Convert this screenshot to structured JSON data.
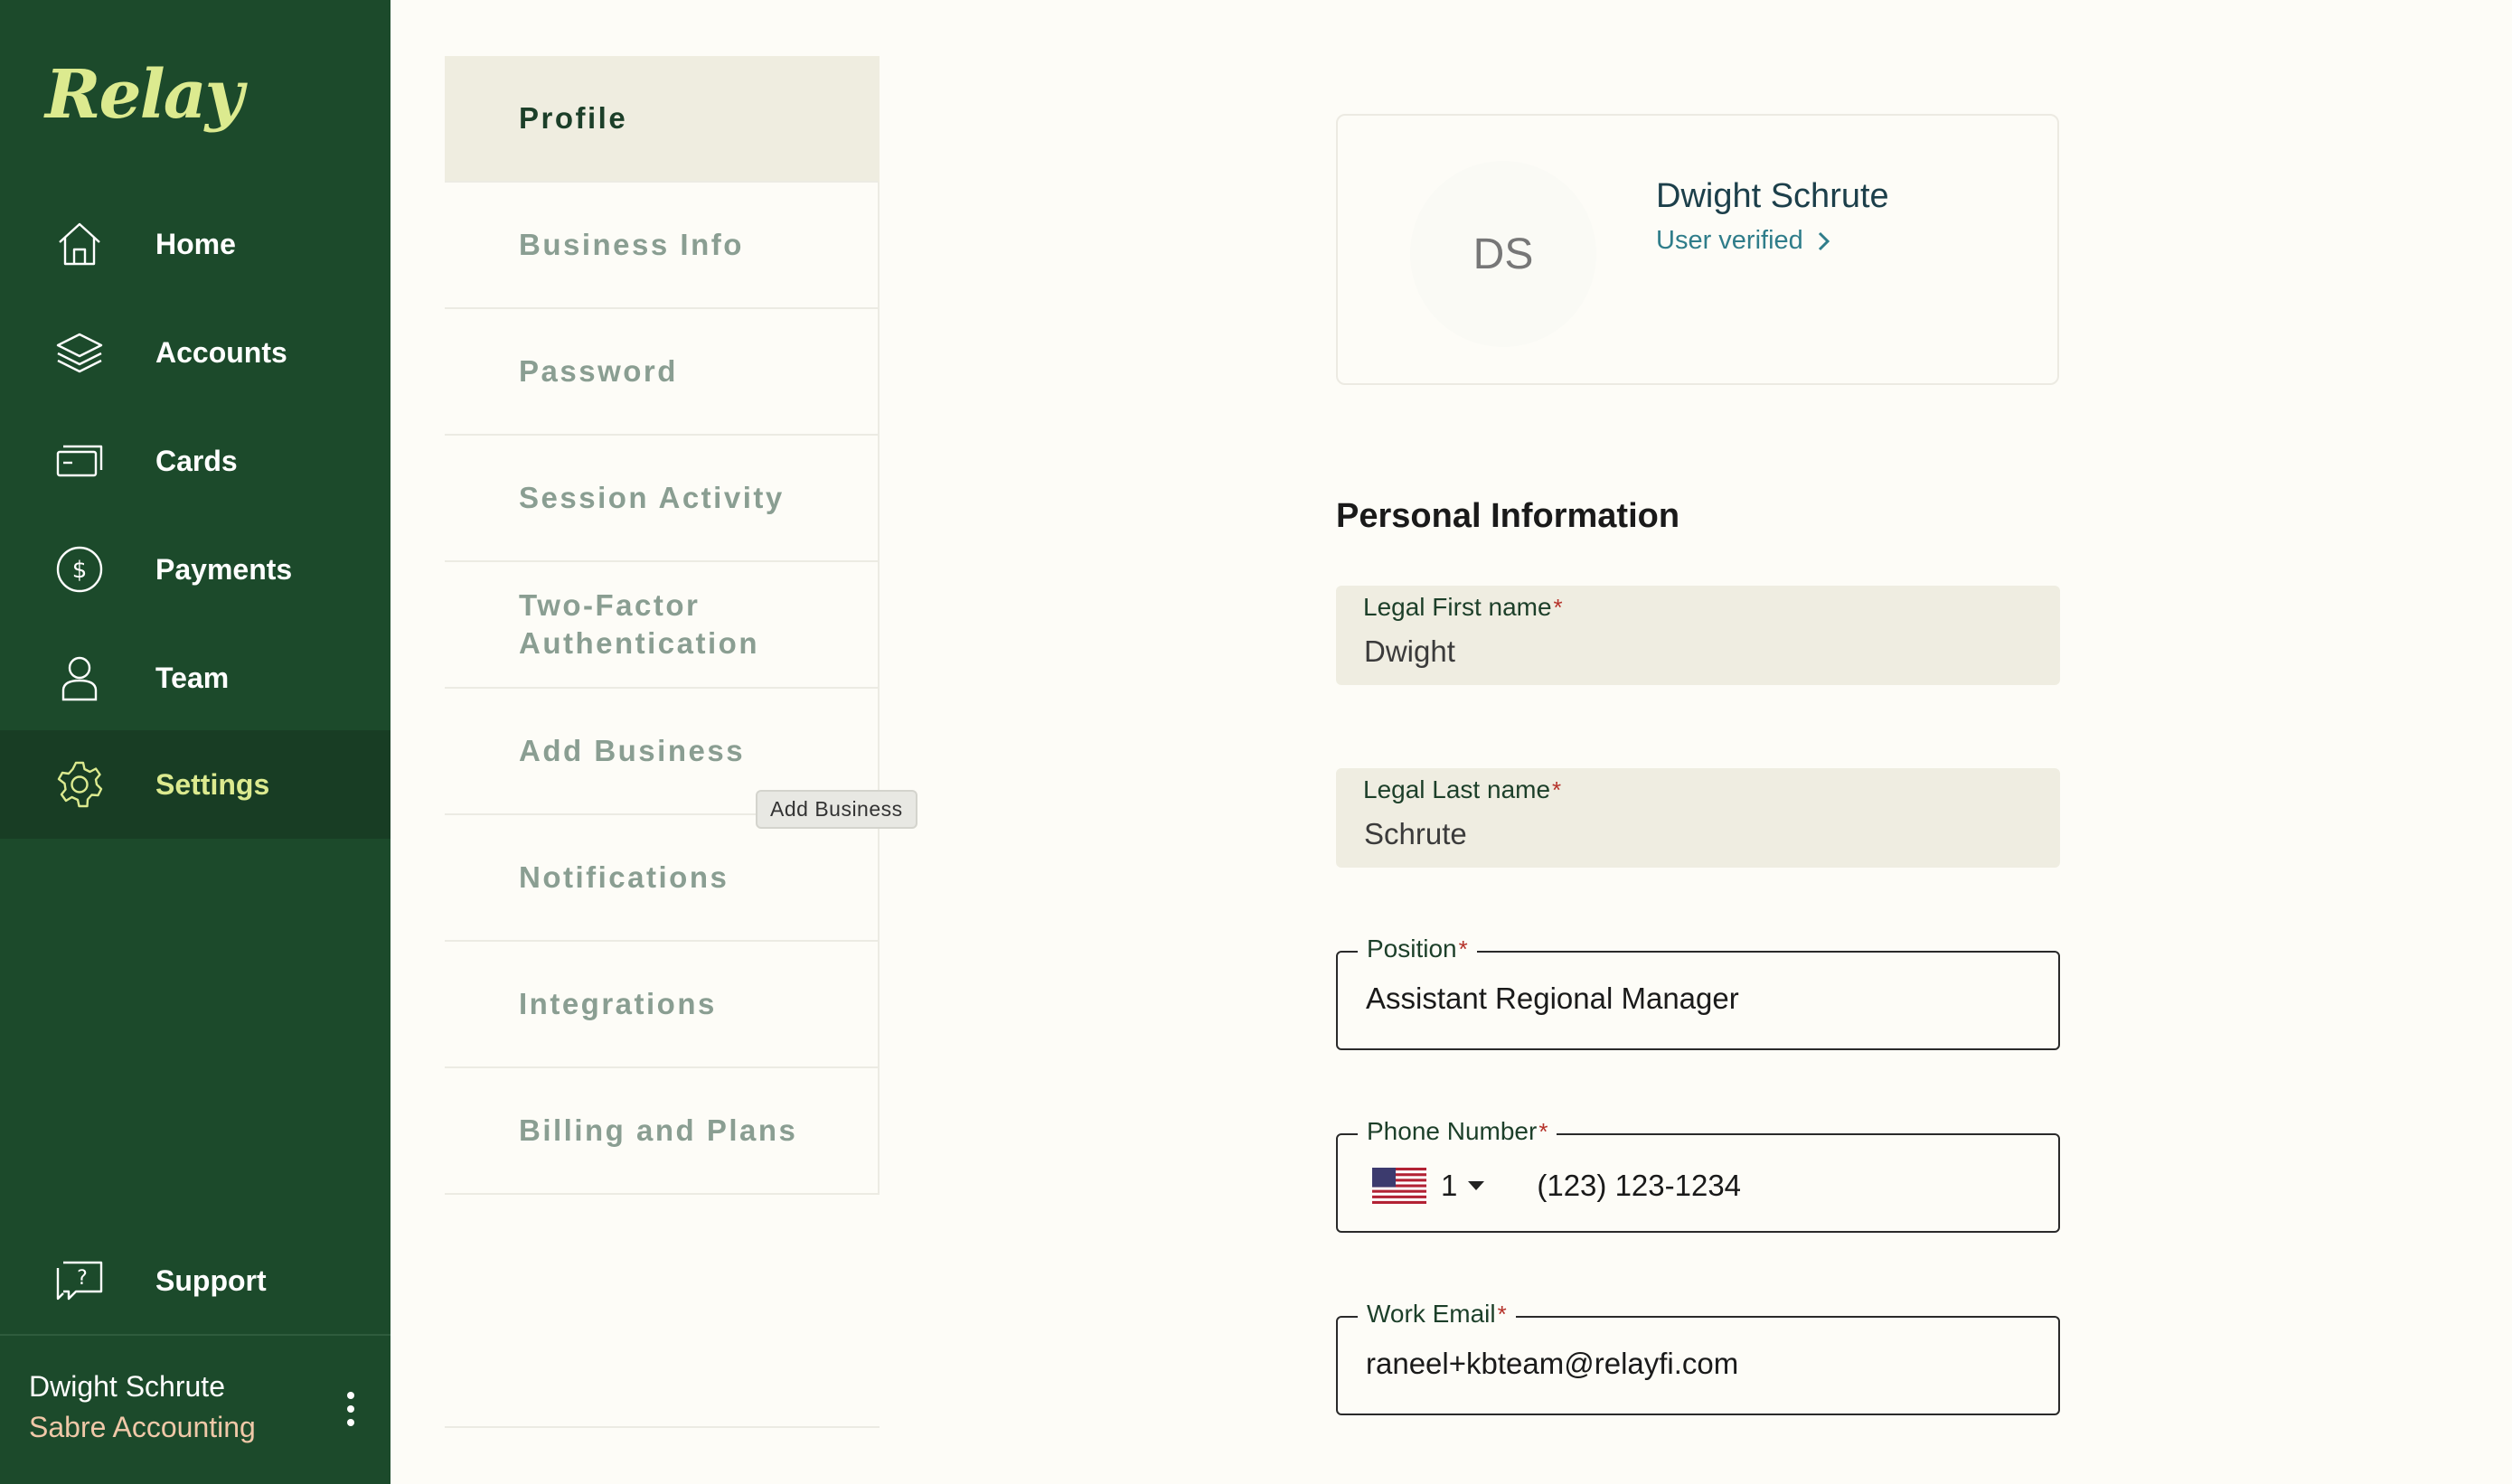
{
  "app": {
    "logo": "Relay"
  },
  "sidebar": {
    "items": [
      {
        "label": "Home",
        "icon": "home-icon"
      },
      {
        "label": "Accounts",
        "icon": "layers-icon"
      },
      {
        "label": "Cards",
        "icon": "card-icon"
      },
      {
        "label": "Payments",
        "icon": "dollar-icon"
      },
      {
        "label": "Team",
        "icon": "person-icon"
      },
      {
        "label": "Settings",
        "icon": "gear-icon",
        "active": true
      }
    ],
    "support": {
      "label": "Support",
      "icon": "help-icon"
    },
    "user": {
      "name": "Dwight Schrute",
      "company": "Sabre Accounting"
    }
  },
  "settings_menu": {
    "items": [
      {
        "label": "Profile",
        "active": true
      },
      {
        "label": "Business Info"
      },
      {
        "label": "Password"
      },
      {
        "label": "Session Activity"
      },
      {
        "label": "Two-Factor Authentication"
      },
      {
        "label": "Add Business"
      },
      {
        "label": "Notifications"
      },
      {
        "label": "Integrations"
      },
      {
        "label": "Billing and Plans"
      }
    ],
    "tooltip": "Add Business"
  },
  "profile_card": {
    "initials": "DS",
    "name": "Dwight Schrute",
    "status": "User verified"
  },
  "personal_info": {
    "title": "Personal Information",
    "first_name": {
      "label": "Legal First name",
      "value": "Dwight"
    },
    "last_name": {
      "label": "Legal Last name",
      "value": "Schrute"
    },
    "position": {
      "label": "Position",
      "value": "Assistant Regional Manager"
    },
    "phone": {
      "label": "Phone Number",
      "country_code": "1",
      "value": "(123) 123-1234"
    },
    "email": {
      "label": "Work Email",
      "value": "raneel+kbteam@relayfi.com"
    },
    "required_marker": "*"
  },
  "colors": {
    "sidebar_bg": "#1c4a2b",
    "sidebar_active_bg": "#183d24",
    "accent_lime": "#dcea8f",
    "page_bg": "#fdfcf7",
    "filled_field_bg": "#efede1",
    "link_teal": "#2f7d8a",
    "required_red": "#b5322a"
  }
}
